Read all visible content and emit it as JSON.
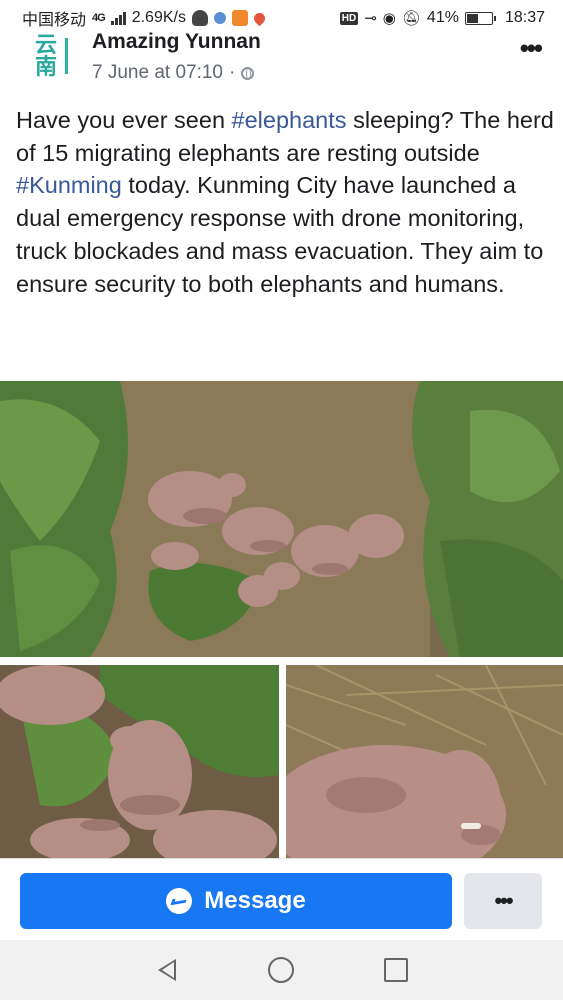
{
  "status_bar": {
    "carrier": "中国移动",
    "network": "4G",
    "speed": "2.69K/s",
    "hd_badge": "HD",
    "battery_percent": "41%",
    "time": "18:37"
  },
  "post": {
    "page_name": "Amazing Yunnan",
    "logo_text": "云南",
    "date": "7 June at 07:10",
    "meta_separator": "·",
    "more_icon": "more-horizontal-icon",
    "text_part1": "Have you ever seen ",
    "hashtag1": "#elephants",
    "text_part2": " sleeping? The herd of 15 migrating elephants are resting outside ",
    "hashtag2": "#Kunming",
    "text_part3": " today. Kunming City have launched a dual emergency response with drone monitoring, truck blockades and mass evacuation. They aim to ensure security to both elephants and humans."
  },
  "cta": {
    "message_label": "Message",
    "message_icon": "messenger-icon",
    "more_label": "•••"
  },
  "nav": {
    "back_icon": "back-icon",
    "home_icon": "home-icon",
    "recents_icon": "recents-icon"
  },
  "colors": {
    "link": "#385898",
    "button_blue": "#1877f2",
    "logo_teal": "#29a8a0"
  }
}
